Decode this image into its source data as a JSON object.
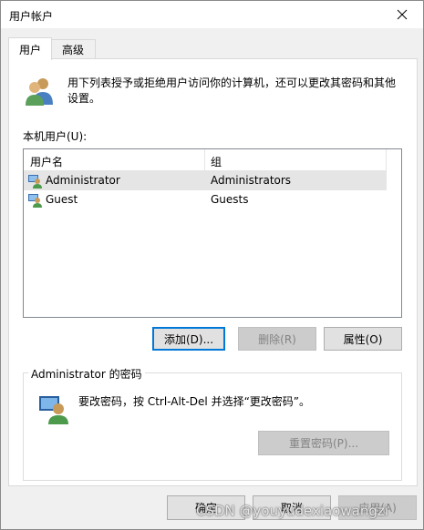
{
  "window": {
    "title": "用户帐户"
  },
  "tabs": [
    {
      "label": "用户"
    },
    {
      "label": "高级"
    }
  ],
  "intro": {
    "text": "用下列表授予或拒绝用户访问你的计算机，还可以更改其密码和其他设置。"
  },
  "local_users": {
    "label": "本机用户(U):",
    "columns": [
      "用户名",
      "组"
    ],
    "rows": [
      {
        "name": "Administrator",
        "group": "Administrators"
      },
      {
        "name": "Guest",
        "group": "Guests"
      }
    ]
  },
  "buttons": {
    "add": "添加(D)...",
    "remove": "删除(R)",
    "properties": "属性(O)"
  },
  "password_group": {
    "title": "Administrator 的密码",
    "text": "要改密码，按 Ctrl-Alt-Del 并选择“更改密码”。",
    "reset_button": "重置密码(P)..."
  },
  "footer": {
    "ok": "确定",
    "cancel": "取消",
    "apply": "应用(A)"
  },
  "watermark": "CSDN @youyudexiaowangzi",
  "colors": {
    "focus": "#0078d7",
    "selected_row": "#e5e5e5",
    "window_bg": "#f0f0f0"
  }
}
